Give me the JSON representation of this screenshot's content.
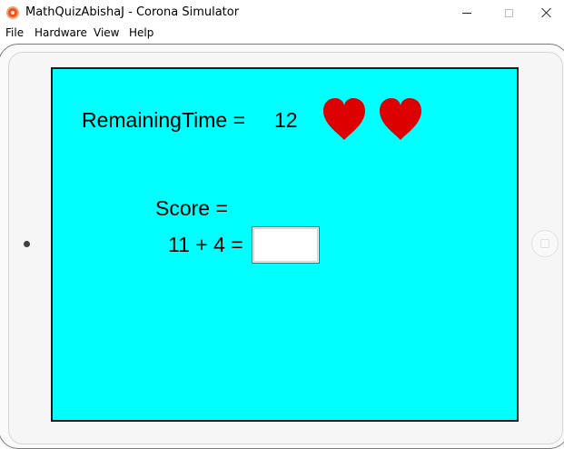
{
  "window": {
    "title": "MathQuizAbishaJ - Corona Simulator",
    "app_icon": "corona-simulator-icon"
  },
  "menu": {
    "items": [
      "File",
      "Hardware",
      "View",
      "Help"
    ]
  },
  "game": {
    "remaining_time_label": "RemainingTime =",
    "remaining_time_value": "12",
    "lives": 2,
    "heart_color": "#dd0000",
    "score_label": "Score =",
    "question": "11 + 4 =",
    "answer_value": "",
    "background_color": "#00ffff"
  }
}
